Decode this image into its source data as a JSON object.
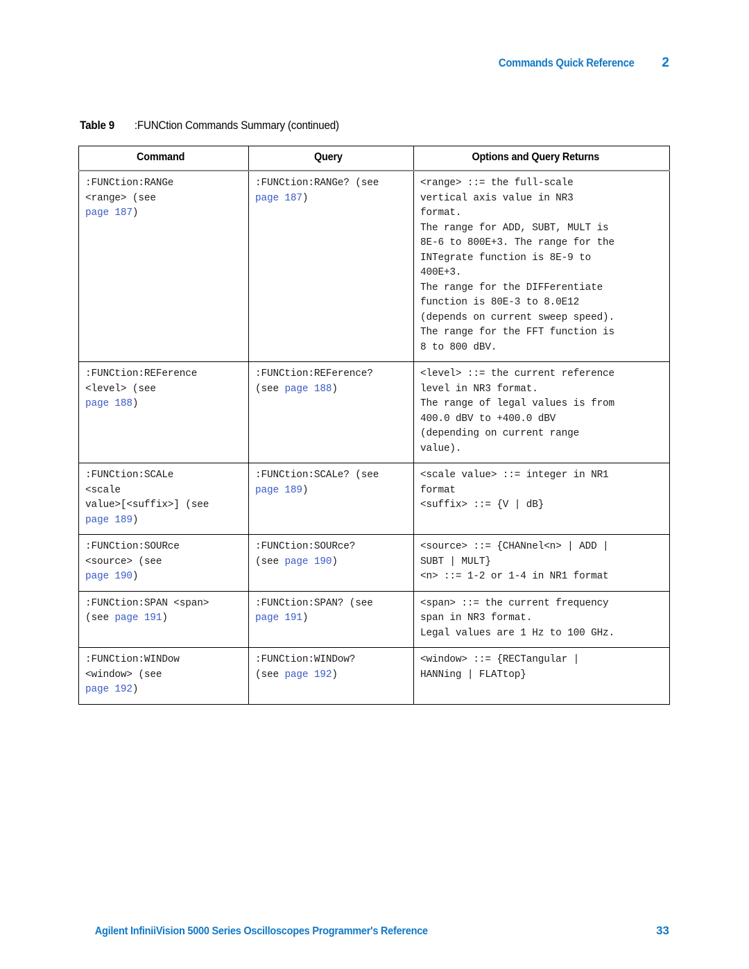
{
  "header": {
    "title": "Commands Quick Reference",
    "chapter": "2"
  },
  "caption": {
    "label": "Table 9",
    "text": ":FUNCtion Commands Summary (continued)"
  },
  "table": {
    "columns": [
      "Command",
      "Query",
      "Options and Query Returns"
    ],
    "rows": [
      {
        "command": ":FUNCtion:RANGe\n<range> (see\npage 187)",
        "command_links": [
          "page 187"
        ],
        "query": ":FUNCtion:RANGe? (see\npage 187)",
        "query_links": [
          "page 187"
        ],
        "options": "<range> ::= the full-scale\nvertical axis value in NR3\nformat.\nThe range for ADD, SUBT, MULT is\n8E-6 to 800E+3. The range for the\nINTegrate function is 8E-9 to\n400E+3.\nThe range for the DIFFerentiate\nfunction is 80E-3 to 8.0E12\n(depends on current sweep speed).\nThe range for the FFT function is\n8 to 800 dBV."
      },
      {
        "command": ":FUNCtion:REFerence\n<level> (see\npage 188)",
        "command_links": [
          "page 188"
        ],
        "query": ":FUNCtion:REFerence?\n(see page 188)",
        "query_links": [
          "page 188"
        ],
        "options": "<level> ::= the current reference\nlevel in NR3 format.\nThe range of legal values is from\n400.0 dBV to +400.0 dBV\n(depending on current range\nvalue)."
      },
      {
        "command": ":FUNCtion:SCALe\n<scale\nvalue>[<suffix>] (see\npage 189)",
        "command_links": [
          "page 189"
        ],
        "query": ":FUNCtion:SCALe? (see\npage 189)",
        "query_links": [
          "page 189"
        ],
        "options": "<scale value> ::= integer in NR1\nformat\n<suffix> ::= {V | dB}"
      },
      {
        "command": ":FUNCtion:SOURce\n<source> (see\npage 190)",
        "command_links": [
          "page 190"
        ],
        "query": ":FUNCtion:SOURce?\n(see page 190)",
        "query_links": [
          "page 190"
        ],
        "options": "<source> ::= {CHANnel<n> | ADD |\nSUBT | MULT}\n<n> ::= 1-2 or 1-4 in NR1 format"
      },
      {
        "command": ":FUNCtion:SPAN <span>\n(see page 191)",
        "command_links": [
          "page 191"
        ],
        "query": ":FUNCtion:SPAN? (see\npage 191)",
        "query_links": [
          "page 191"
        ],
        "options": "<span> ::= the current frequency\nspan in NR3 format.\nLegal values are 1 Hz to 100 GHz."
      },
      {
        "command": ":FUNCtion:WINDow\n<window> (see\npage 192)",
        "command_links": [
          "page 192"
        ],
        "query": ":FUNCtion:WINDow?\n(see page 192)",
        "query_links": [
          "page 192"
        ],
        "options": "<window> ::= {RECTangular |\nHANNing | FLATtop}"
      }
    ]
  },
  "footer": {
    "text": "Agilent InfiniiVision 5000 Series Oscilloscopes Programmer's Reference",
    "page_number": "33"
  },
  "colors": {
    "accent_blue": "#1279c6",
    "link_blue": "#3a59c4",
    "rule_gray": "#8a8a8a",
    "border_black": "#000000"
  }
}
